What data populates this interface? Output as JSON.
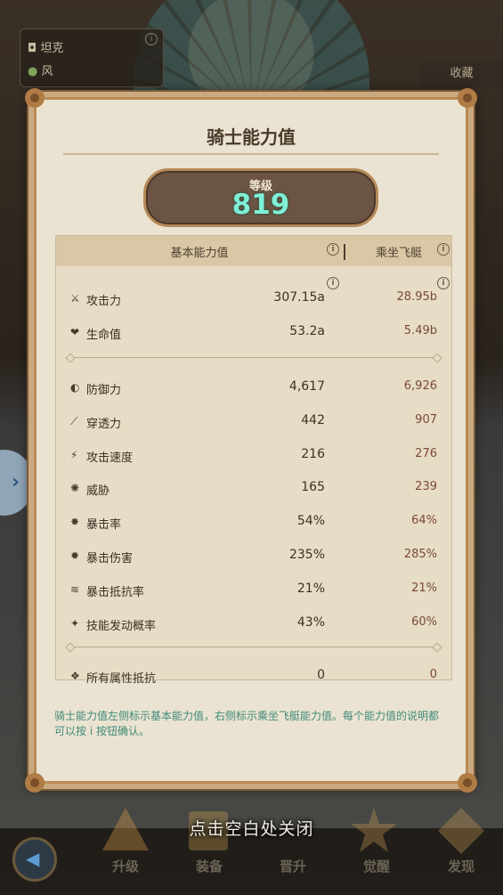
{
  "background": {
    "character_card": {
      "class_label": "坦克",
      "element_label": "风"
    },
    "favorite_button": "收藏"
  },
  "dialog": {
    "title": "骑士能力值",
    "level": {
      "label": "等级",
      "value": "819"
    },
    "table": {
      "header_base": "基本能力值",
      "header_ride": "乘坐飞艇",
      "group1": [
        {
          "icon": "sword-icon",
          "name": "攻击力",
          "base": "307.15a",
          "ride": "28.95b"
        },
        {
          "icon": "heart-icon",
          "name": "生命值",
          "base": "53.2a",
          "ride": "5.49b"
        }
      ],
      "group2": [
        {
          "icon": "shield-icon",
          "name": "防御力",
          "base": "4,617",
          "ride": "6,926"
        },
        {
          "icon": "penetration-icon",
          "name": "穿透力",
          "base": "442",
          "ride": "907"
        },
        {
          "icon": "attack-speed-icon",
          "name": "攻击速度",
          "base": "216",
          "ride": "276"
        },
        {
          "icon": "threat-icon",
          "name": "威胁",
          "base": "165",
          "ride": "239"
        },
        {
          "icon": "crit-rate-icon",
          "name": "暴击率",
          "base": "54%",
          "ride": "64%"
        },
        {
          "icon": "crit-damage-icon",
          "name": "暴击伤害",
          "base": "235%",
          "ride": "285%"
        },
        {
          "icon": "crit-resist-icon",
          "name": "暴击抵抗率",
          "base": "21%",
          "ride": "21%"
        },
        {
          "icon": "skill-trigger-icon",
          "name": "技能发动概率",
          "base": "43%",
          "ride": "60%"
        }
      ],
      "group3": [
        {
          "icon": "all-element-resist-icon",
          "name": "所有属性抵抗",
          "base": "0",
          "ride": "0"
        }
      ]
    },
    "description": "骑士能力值左侧标示基本能力值，右侧标示乘坐飞艇能力值。每个能力值的说明都可以按 i 按钮确认。"
  },
  "close_hint": "点击空白处关闭",
  "bottom_nav": {
    "items": [
      "升级",
      "装备",
      "晋升",
      "觉醒",
      "发现"
    ]
  }
}
